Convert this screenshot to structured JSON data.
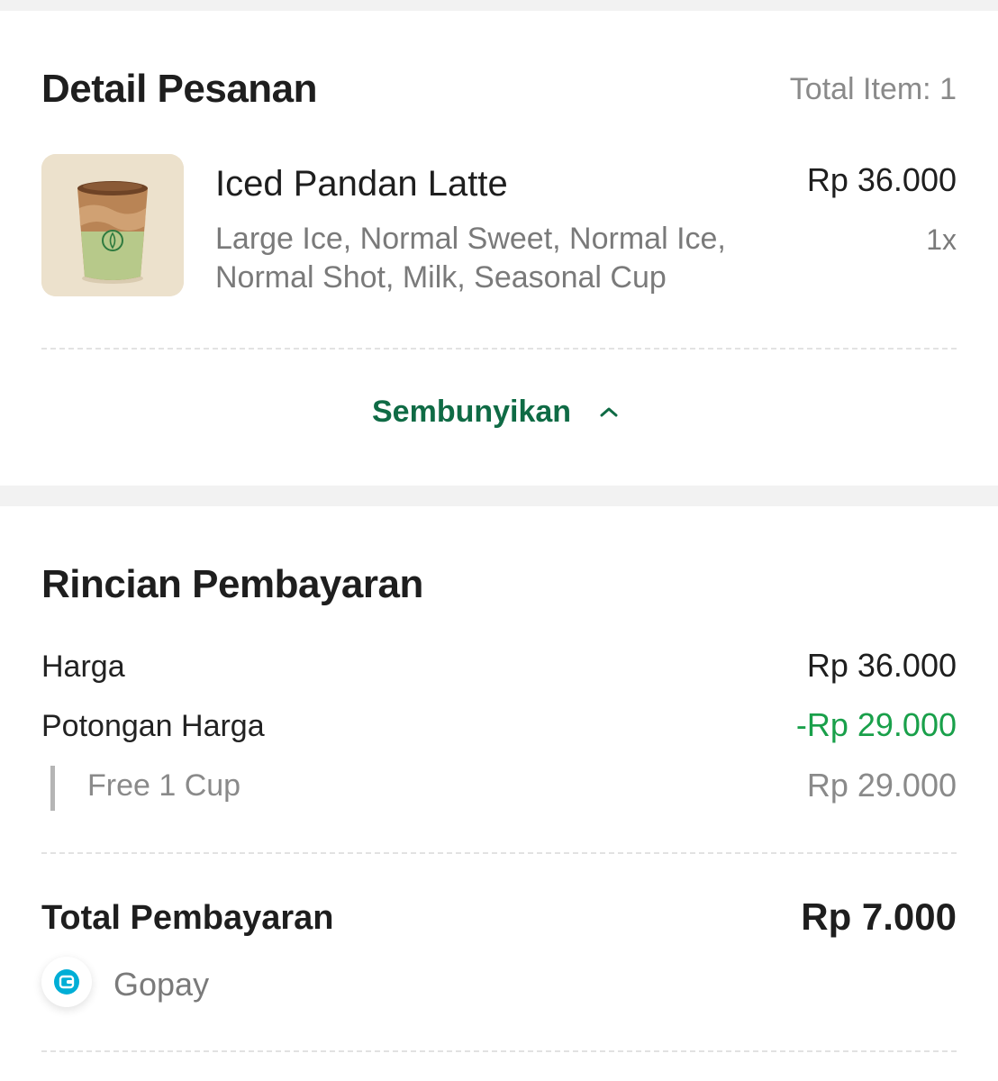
{
  "order_detail": {
    "title": "Detail Pesanan",
    "total_items": "Total Item: 1",
    "item": {
      "image": "iced-latte-cup-image",
      "name": "Iced Pandan Latte",
      "options": "Large Ice, Normal Sweet, Normal Ice, Normal Shot, Milk, Seasonal Cup",
      "price": "Rp 36.000",
      "quantity": "1x"
    },
    "toggle_label": "Sembunyikan",
    "toggle_icon": "chevron-up-icon"
  },
  "payment_detail": {
    "title": "Rincian Pembayaran",
    "price_label": "Harga",
    "price_value": "Rp 36.000",
    "discount_label": "Potongan Harga",
    "discount_value": "-Rp 29.000",
    "promo_label": "Free 1 Cup",
    "promo_value": "Rp 29.000",
    "total_label": "Total Pembayaran",
    "total_value": "Rp 7.000",
    "payment_method": "Gopay",
    "payment_icon": "wallet-icon"
  },
  "colors": {
    "accent_green": "#0f6b45",
    "discount_green": "#19a04a",
    "gopay_blue": "#00aed6"
  }
}
